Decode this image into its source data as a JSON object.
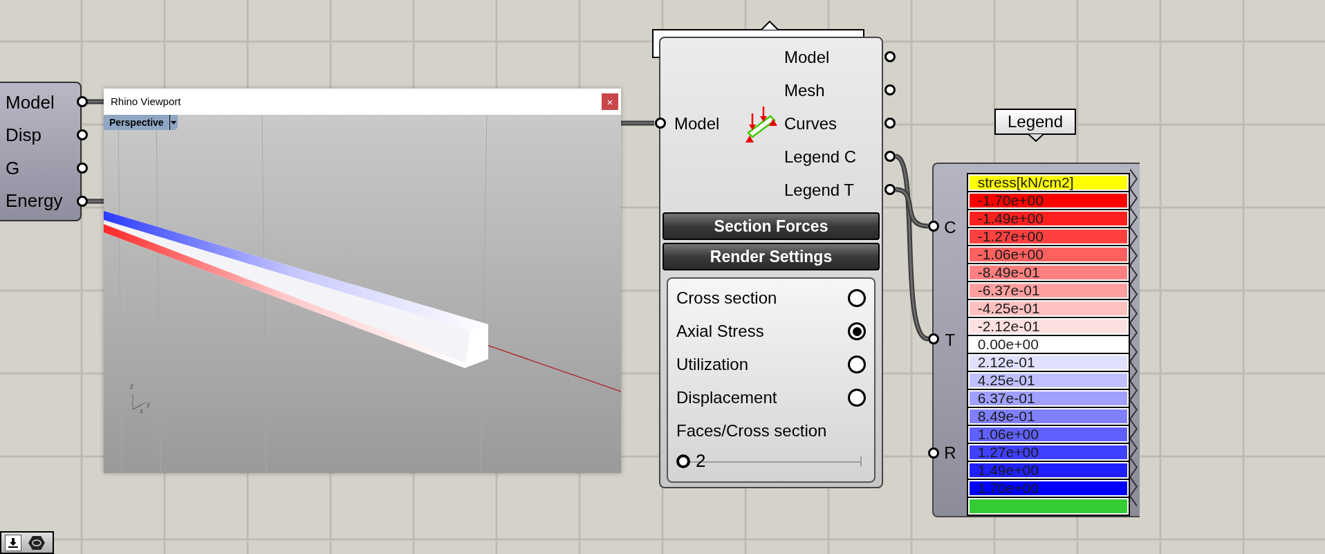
{
  "source_component": {
    "outputs": [
      "Model",
      "Disp",
      "G",
      "Energy"
    ]
  },
  "viewport_window": {
    "title": "Rhino Viewport",
    "close": "×",
    "view_menu": "Perspective",
    "axis_labels": [
      "z",
      "x",
      "y"
    ]
  },
  "beam_view_component": {
    "inputs": [
      "Model"
    ],
    "outputs": [
      "Model",
      "Mesh",
      "Curves",
      "Legend C",
      "Legend T"
    ],
    "buttons": [
      "Section Forces",
      "Render Settings"
    ],
    "options": [
      {
        "label": "Cross section",
        "selected": false
      },
      {
        "label": "Axial Stress",
        "selected": true
      },
      {
        "label": "Utilization",
        "selected": false
      },
      {
        "label": "Displacement",
        "selected": false
      }
    ],
    "slider": {
      "label": "Faces/Cross section",
      "value": "2",
      "level": 0
    }
  },
  "legend_component": {
    "tag": "Legend",
    "inputs": [
      "C",
      "T",
      "R"
    ],
    "rows": [
      {
        "label": "stress[kN/cm2]",
        "color": "#ffff00"
      },
      {
        "label": "-1.70e+00",
        "color": "#ff0000"
      },
      {
        "label": "-1.49e+00",
        "color": "#ff2020"
      },
      {
        "label": "-1.27e+00",
        "color": "#ff4040"
      },
      {
        "label": "-1.06e+00",
        "color": "#ff6060"
      },
      {
        "label": "-8.49e-01",
        "color": "#ff8080"
      },
      {
        "label": "-6.37e-01",
        "color": "#ffa0a0"
      },
      {
        "label": "-4.25e-01",
        "color": "#ffc0c0"
      },
      {
        "label": "-2.12e-01",
        "color": "#ffe0e0"
      },
      {
        "label": "0.00e+00",
        "color": "#ffffff"
      },
      {
        "label": "2.12e-01",
        "color": "#e0e0ff"
      },
      {
        "label": "4.25e-01",
        "color": "#c0c0ff"
      },
      {
        "label": "6.37e-01",
        "color": "#a0a0ff"
      },
      {
        "label": "8.49e-01",
        "color": "#8080ff"
      },
      {
        "label": "1.06e+00",
        "color": "#6060ff"
      },
      {
        "label": "1.27e+00",
        "color": "#4040ff"
      },
      {
        "label": "1.49e+00",
        "color": "#2020ff"
      },
      {
        "label": "1.70e+00",
        "color": "#0000ff"
      },
      {
        "color": "#33cc33"
      }
    ]
  }
}
